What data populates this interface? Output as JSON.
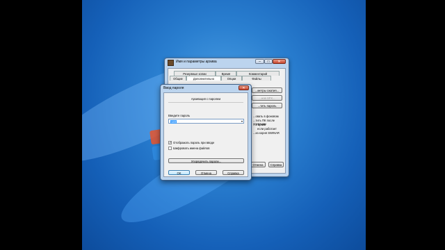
{
  "back_window": {
    "title": "Имя и параметры архива",
    "tabs_top": [
      "Резервные копии",
      "Время",
      "Комментарий"
    ],
    "tabs_bottom": [
      "Общие",
      "Дополнительно",
      "Опции",
      "Файлы"
    ],
    "active_tab": "Дополнительно",
    "side_buttons": [
      "...метры сжатия...",
      "...нов SFX...",
      "...тить пароль"
    ],
    "side_texts": [
      "...овать в фоновом",
      "...тить ПК после операции",
      "...ь архив",
      "если работает",
      "...из корня SWINAR"
    ],
    "footer_buttons": [
      "Отмена",
      "Справка"
    ]
  },
  "dialog": {
    "title": "Ввод пароля",
    "heading": "Архивация с паролем",
    "password_label": "Введите пароль",
    "password_value": "123",
    "checkbox_show": {
      "label": "Отображать пароль при вводе",
      "checked": true
    },
    "checkbox_encrypt": {
      "label": "Шифровать имена файлов",
      "checked": false
    },
    "organize_button": "Упорядочить пароли...",
    "ok": "OK",
    "cancel": "Отмена",
    "help": "Справка"
  },
  "colors": {
    "desktop": "#1f6fc4",
    "frame": "#bcd4ee",
    "close": "#c8442c"
  }
}
